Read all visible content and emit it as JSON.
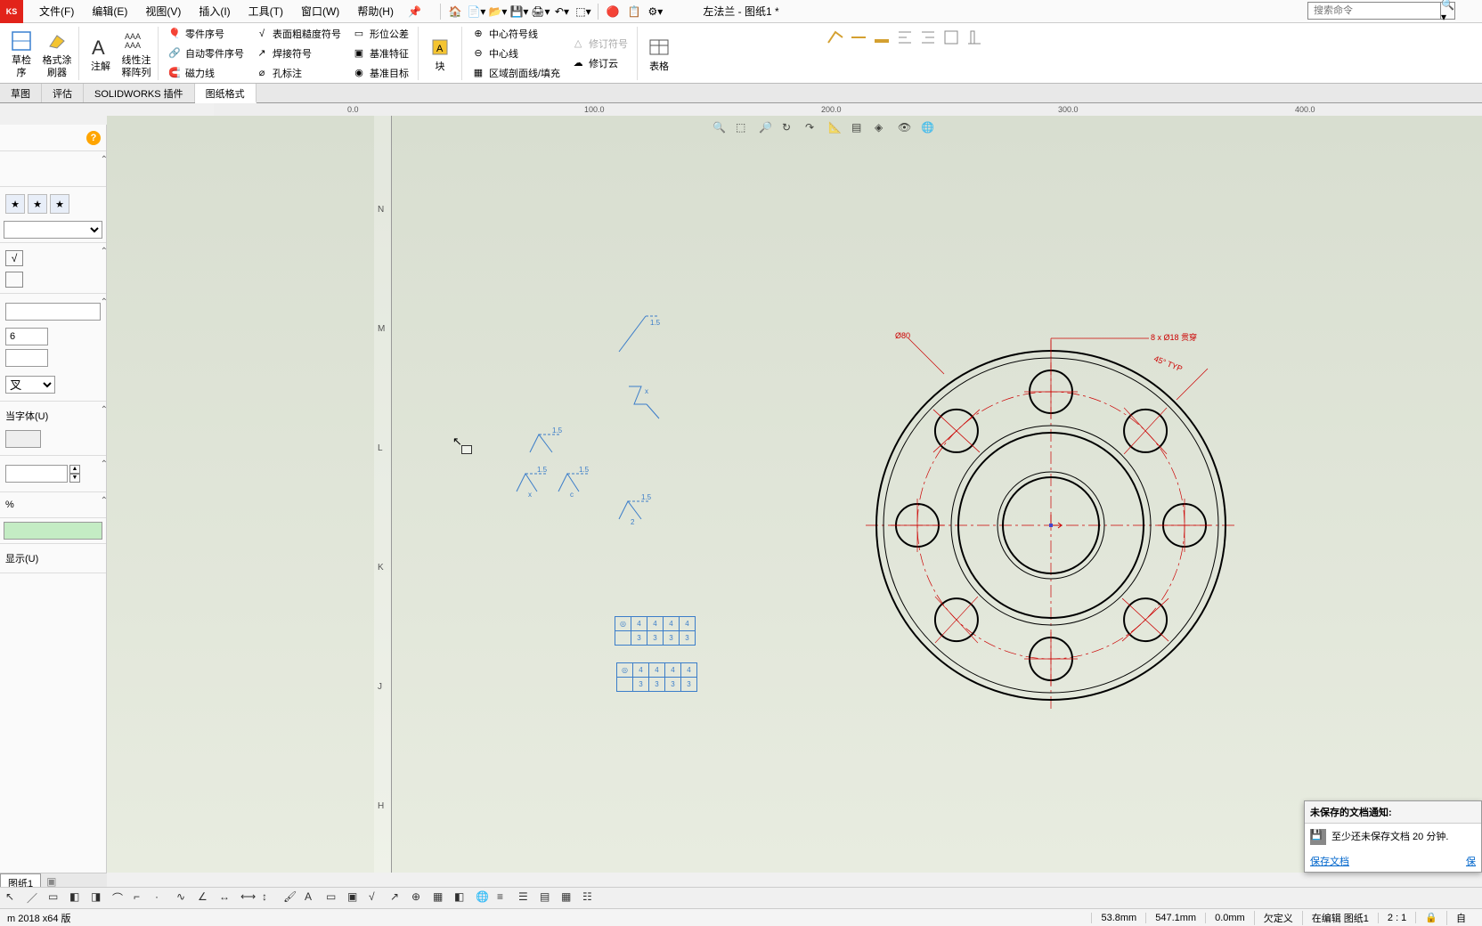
{
  "app_logo_text": "KS",
  "menu": {
    "file": "文件(F)",
    "edit": "编辑(E)",
    "view": "视图(V)",
    "insert": "插入(I)",
    "tools": "工具(T)",
    "window": "窗口(W)",
    "help": "帮助(H)"
  },
  "document_title": "左法兰 - 图纸1 *",
  "search": {
    "placeholder": "搜索命令"
  },
  "ribbon": {
    "big1": {
      "label_a": "草检",
      "label_b": "序"
    },
    "big2": {
      "label_a": "格式涂",
      "label_b": "刷器"
    },
    "big3": "注解",
    "big4": {
      "label_a": "线性注",
      "label_b": "释阵列"
    },
    "grp1": [
      "零件序号",
      "自动零件序号",
      "磁力线"
    ],
    "grp2": [
      "表面粗糙度符号",
      "焊接符号",
      "孔标注"
    ],
    "grp3": [
      "形位公差",
      "基准特征",
      "基准目标"
    ],
    "big_block": "块",
    "grp4": [
      "中心符号线",
      "中心线",
      "区域剖面线/填充"
    ],
    "grp5": [
      "修订符号",
      "修订云"
    ],
    "big_table": "表格"
  },
  "view_icons": [
    "zoom-fit",
    "zoom-area",
    "zoom",
    "rotate",
    "redo",
    "section",
    "layer",
    "vis",
    "eye",
    "globe"
  ],
  "tabs": [
    "草图",
    "评估",
    "SOLIDWORKS 插件",
    "图纸格式"
  ],
  "ruler_ticks": [
    "0.0",
    "100.0",
    "200.0",
    "300.0",
    "400.0"
  ],
  "vruler_labels": [
    "N",
    "M",
    "L",
    "K",
    "J",
    "H"
  ],
  "panel": {
    "input_value": "6",
    "dropdown_value": "叉",
    "checkbox1": "当字体(U)",
    "checkbox2": "显示(U)"
  },
  "flange": {
    "dim_top": "8 x Ø18 贯穿",
    "dim_angle": "45°  TYP",
    "dia_label": "Ø80"
  },
  "minitable1": [
    [
      "◎",
      "4",
      "4",
      "4",
      "4"
    ],
    [
      "",
      "3",
      "3",
      "3",
      "3"
    ]
  ],
  "minitable2": [
    [
      "◎",
      "4",
      "4",
      "4",
      "4"
    ],
    [
      "",
      "3",
      "3",
      "3",
      "3"
    ]
  ],
  "notification": {
    "title": "未保存的文档通知:",
    "body": "至少还未保存文档 20 分钟.",
    "save": "保存文档",
    "other": "保"
  },
  "sheet_tab": "图纸1",
  "statusbar": {
    "version": "m 2018 x64 版",
    "x": "53.8mm",
    "y": "547.1mm",
    "z": "0.0mm",
    "def": "欠定义",
    "edit": "在编辑 图纸1",
    "zoom": "2 : 1",
    "custom": "自"
  }
}
